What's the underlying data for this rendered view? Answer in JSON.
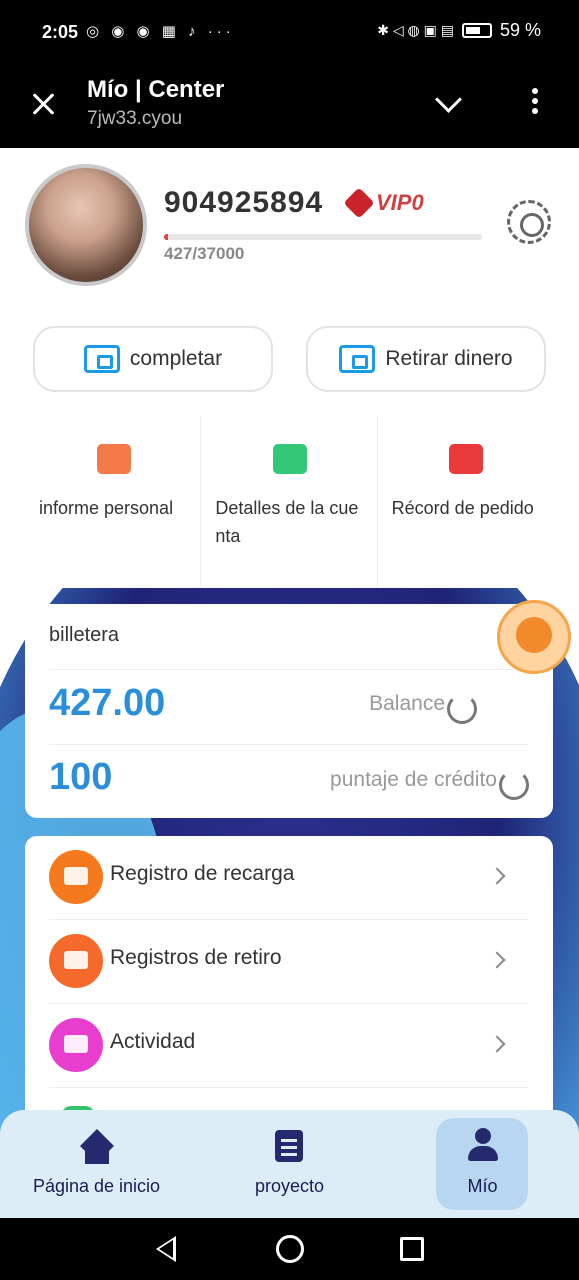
{
  "status_bar": {
    "time": "2:05",
    "left_icons": "◎ ◉ ◉ ▦ ♪ ···",
    "right_icons": "✱ ◁ ◍ ▣ ▤",
    "battery": "59 %"
  },
  "browser": {
    "title": "Mío | Center",
    "url": "7jw33.cyou"
  },
  "profile": {
    "user_id": "904925894",
    "vip_label": "VIP0",
    "progress_text": "427/37000",
    "progress_fraction": 0.0115
  },
  "actions": {
    "complete_label": "completar",
    "withdraw_label": "Retirar dinero"
  },
  "quick_menu": [
    {
      "label": "informe personal",
      "icon": "chart-board-icon"
    },
    {
      "label": "Detalles de la cuenta",
      "icon": "id-card-icon"
    },
    {
      "label": "Récord de pedido",
      "icon": "gamepad-icon"
    }
  ],
  "wallet": {
    "title": "billetera",
    "balance_value": "427.00",
    "balance_label": "Balance",
    "credit_value": "100",
    "credit_label": "puntaje de crédito"
  },
  "list": [
    {
      "label": "Registro de recarga",
      "icon": "card-icon"
    },
    {
      "label": "Registros de retiro",
      "icon": "stopwatch-icon"
    },
    {
      "label": "Actividad",
      "icon": "gift-icon"
    }
  ],
  "tabs": [
    {
      "label": "Página de inicio",
      "icon": "home-icon"
    },
    {
      "label": "proyecto",
      "icon": "document-icon"
    },
    {
      "label": "Mío",
      "icon": "person-icon",
      "active": true
    }
  ],
  "colors": {
    "accent": "#2a8fd8",
    "nav_dark": "#252a6e",
    "tabbar_bg": "#dcedf8",
    "progress_fill": "#e04040"
  }
}
